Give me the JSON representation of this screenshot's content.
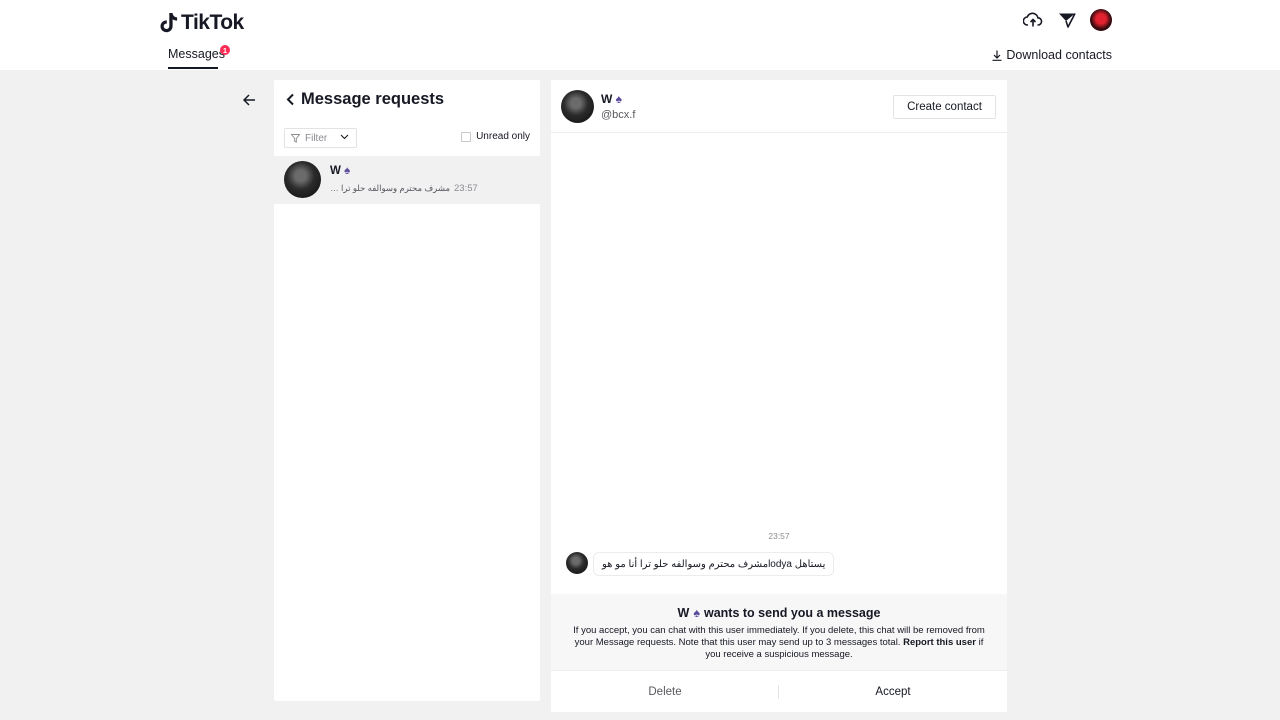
{
  "header": {
    "brand": "TikTok",
    "tab_label": "Messages",
    "tab_badge": "1",
    "download_label": "Download contacts",
    "icons": [
      "upload-cloud-icon",
      "inbox-send-icon",
      "profile-avatar"
    ]
  },
  "left_panel": {
    "title": "Message requests",
    "filter_label": "Filter",
    "unread_label": "Unread only",
    "conversations": [
      {
        "name": "W",
        "name_suffix": "♠",
        "preview": "مشرف محترم وسوالفه حلو ترا أنا مو هو",
        "time": "23:57"
      }
    ]
  },
  "chat": {
    "name": "W",
    "name_suffix": "♠",
    "handle": "@bcx.f",
    "create_contact_label": "Create contact",
    "message_time": "23:57",
    "message_text": "يستاهل lodyaمشرف محترم وسوالفه حلو ترا أنا مو هو",
    "request": {
      "name": "W",
      "name_suffix": "♠",
      "title_rest": "wants to send you a message",
      "body": "If you accept, you can chat with this user immediately. If you delete, this chat will be removed from your Message requests. Note that this user may send up to 3 messages total.",
      "report_link": "Report this user",
      "body_tail": "if you receive a suspicious message."
    },
    "delete_label": "Delete",
    "accept_label": "Accept"
  },
  "colors": {
    "accent": "#fe2c55",
    "text": "#161823",
    "background": "#f1f1f2"
  }
}
